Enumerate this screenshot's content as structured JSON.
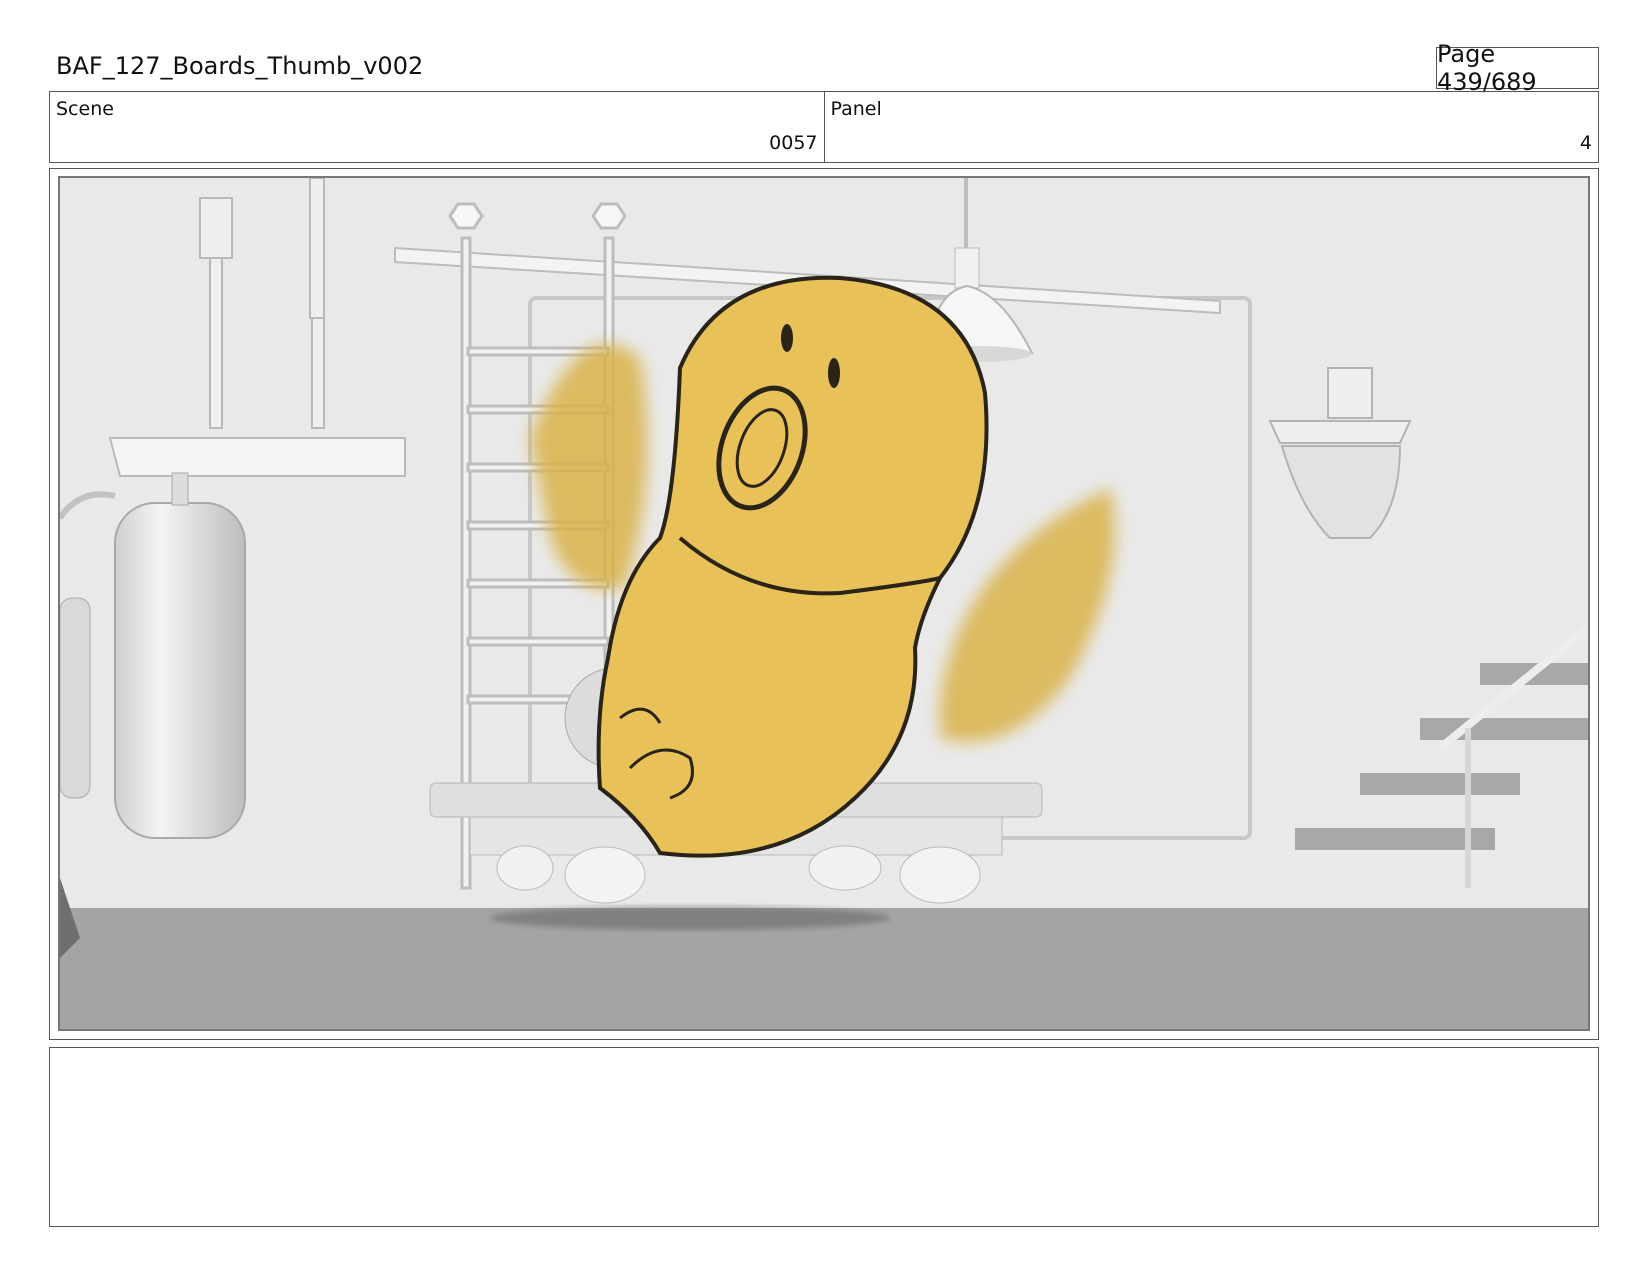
{
  "header": {
    "document_title": "BAF_127_Boards_Thumb_v002",
    "page_label": "Page 439/689"
  },
  "info": {
    "scene_label": "Scene",
    "scene_value": "0057",
    "panel_label": "Panel",
    "panel_value": "4"
  },
  "frame": {
    "description_icon": "storyboard-frame-image",
    "colors": {
      "background": "#e9e9e9",
      "floor": "#a4a4a4",
      "character": "#e8c158",
      "outline": "#2a2418"
    }
  },
  "notes": {
    "text": ""
  }
}
